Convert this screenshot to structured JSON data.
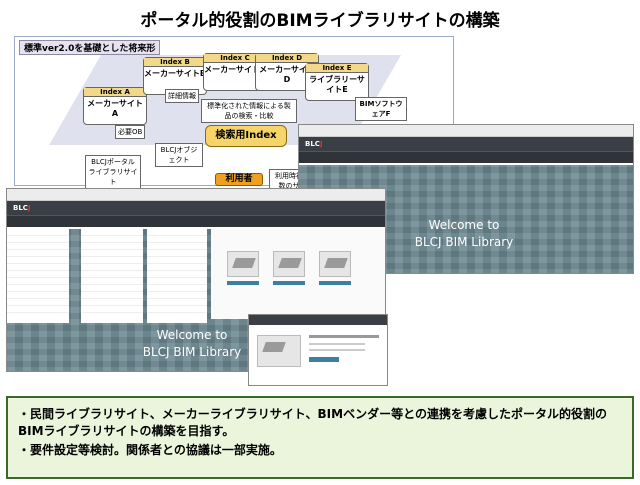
{
  "title": "ポータル的役割のBIMライブラリサイトの構築",
  "diagram": {
    "tag": "標準ver2.0を基礎とした将来形",
    "sites": [
      {
        "index": "Index A",
        "name": "メーカーサイトA"
      },
      {
        "index": "Index B",
        "name": "メーカーサイトB"
      },
      {
        "index": "Index C",
        "name": "メーカーサイトC"
      },
      {
        "index": "Index D",
        "name": "メーカーサイトD"
      },
      {
        "index": "Index E",
        "name": "ライブラリーサイトE"
      }
    ],
    "detail_label": "詳細情報",
    "standard_label": "標準化された情報による製品の検索・比較",
    "bim_software": "BIMソフトウェアF",
    "required_label": "必要OB",
    "portal_label": "BLCJポータルライブラリサイト",
    "object_label": "BLCJオブジェクト",
    "index_main": "検索用Index",
    "user": "利用者",
    "plural_label": "利用時複数のサ"
  },
  "windows": {
    "back": {
      "logo_main": "BLC",
      "logo_accent": "J",
      "welcome_line1": "Welcome to",
      "welcome_line2": "BLCJ BIM Library"
    },
    "front": {
      "logo_main": "BLC",
      "logo_accent": "J",
      "welcome_line1": "Welcome to",
      "welcome_line2": "BLCJ BIM Library"
    }
  },
  "notes": [
    "・民間ライブラリサイト、メーカーライブラリサイト、BIMベンダー等との連携を考慮したポータル的役割のBIMライブラリサイトの構築を目指す。",
    "・要件設定等検討。関係者との協議は一部実施。"
  ],
  "colors": {
    "index_yellow": "#f5d46a",
    "user_orange": "#f0a020",
    "notes_bg": "#eaf5dc",
    "notes_border": "#3a6a2a",
    "navbar": "#3a3f45",
    "hero": "#6d8a93"
  }
}
